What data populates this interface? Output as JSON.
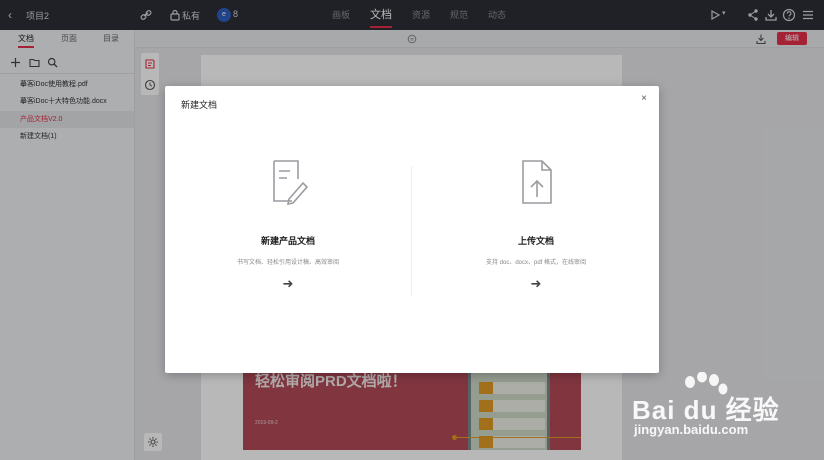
{
  "topbar": {
    "project_name": "项目2",
    "privacy_label": "私有",
    "avatar_letter": "e",
    "member_count": "8",
    "tabs": [
      {
        "label": "画板",
        "active": false
      },
      {
        "label": "文档",
        "active": true
      },
      {
        "label": "资源",
        "active": false
      },
      {
        "label": "规范",
        "active": false
      },
      {
        "label": "动态",
        "active": false
      }
    ],
    "icons": [
      "back-icon",
      "link-icon",
      "lock-icon",
      "play-icon",
      "share-icon",
      "download-icon",
      "help-icon",
      "menu-icon"
    ]
  },
  "left_panel": {
    "tabs": [
      {
        "label": "文档",
        "active": true
      },
      {
        "label": "页面",
        "active": false
      },
      {
        "label": "目录",
        "active": false
      }
    ],
    "tools": [
      "plus-icon",
      "folder-icon",
      "search-icon"
    ],
    "files": [
      {
        "name": "摹客iDoc使用教程.pdf",
        "active": false
      },
      {
        "name": "摹客iDoc十大特色功能.docx",
        "active": false
      },
      {
        "name": "产品文档V2.0",
        "active": true
      },
      {
        "name": "新建文档(1)",
        "active": false
      }
    ]
  },
  "doc_toolbar": {
    "edit_label": "编辑"
  },
  "background_slide": {
    "title": "轻松审阅PRD文档啦！",
    "date": "2019-09-2"
  },
  "modal": {
    "title": "新建文档",
    "close_glyph": "×",
    "options": [
      {
        "name": "新建产品文档",
        "description": "书写文档、轻松引用设计稿、高效审阅",
        "arrow": "➜",
        "icon": "edit-document-icon"
      },
      {
        "name": "上传文档",
        "description": "支持 doc、docx、pdf 格式，在线审阅",
        "arrow": "➜",
        "icon": "upload-document-icon"
      }
    ]
  },
  "watermark": {
    "brand": "Bai du 经验",
    "url": "jingyan.baidu.com"
  },
  "colors": {
    "accent": "#e5304a",
    "topbar_bg": "#2b2e35",
    "slide_bg": "#b24a58"
  }
}
